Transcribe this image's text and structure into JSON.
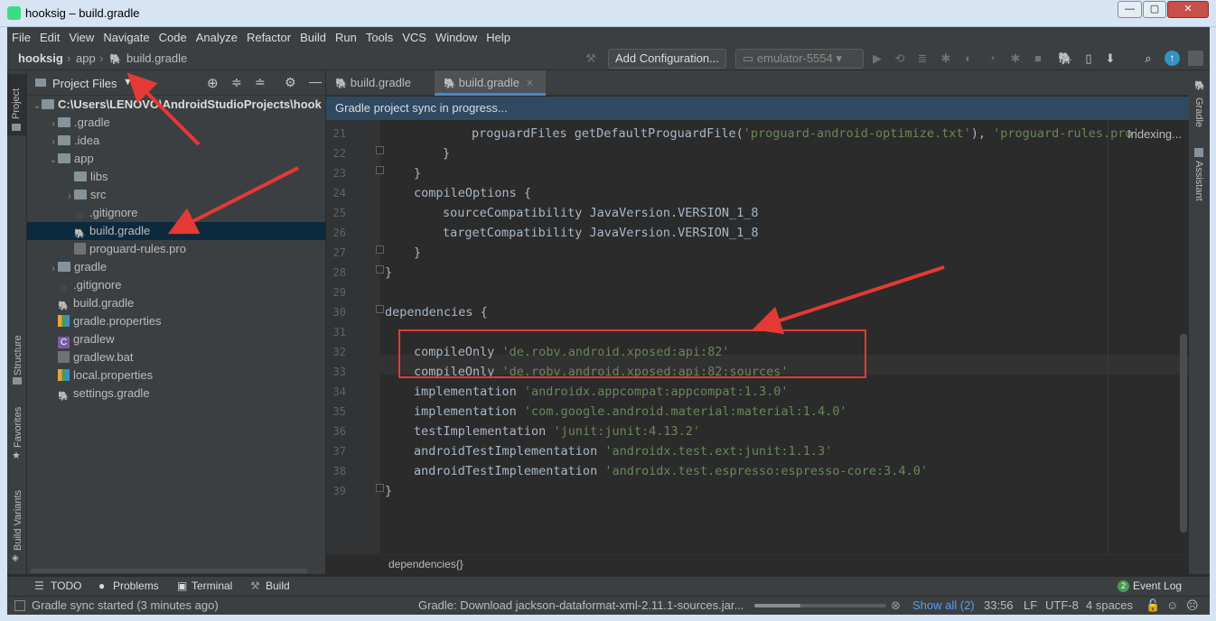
{
  "window": {
    "title": "hooksig – build.gradle"
  },
  "menu": [
    "File",
    "Edit",
    "View",
    "Navigate",
    "Code",
    "Analyze",
    "Refactor",
    "Build",
    "Run",
    "Tools",
    "VCS",
    "Window",
    "Help"
  ],
  "nav": {
    "project": "hooksig",
    "module": "app",
    "file": "build.gradle"
  },
  "toolbar": {
    "add_config": "Add Configuration...",
    "device": "emulator-5554"
  },
  "left_tabs": {
    "project": "Project",
    "structure": "Structure",
    "favorites": "Favorites",
    "build_variants": "Build Variants"
  },
  "right_tabs": {
    "gradle": "Gradle",
    "assistant": "Assistant"
  },
  "project_panel": {
    "view_selector": "Project Files",
    "tree": [
      {
        "label": "C:\\Users\\LENOVO\\AndroidStudioProjects\\hook",
        "depth": 0,
        "arrow": "down",
        "kind": "root"
      },
      {
        "label": ".gradle",
        "depth": 1,
        "arrow": "right",
        "kind": "folder"
      },
      {
        "label": ".idea",
        "depth": 1,
        "arrow": "right",
        "kind": "folder"
      },
      {
        "label": "app",
        "depth": 1,
        "arrow": "down",
        "kind": "folder"
      },
      {
        "label": "libs",
        "depth": 2,
        "arrow": "",
        "kind": "folder"
      },
      {
        "label": "src",
        "depth": 2,
        "arrow": "right",
        "kind": "folder"
      },
      {
        "label": ".gitignore",
        "depth": 2,
        "arrow": "",
        "kind": "git"
      },
      {
        "label": "build.gradle",
        "depth": 2,
        "arrow": "",
        "kind": "gradle",
        "selected": true
      },
      {
        "label": "proguard-rules.pro",
        "depth": 2,
        "arrow": "",
        "kind": "file"
      },
      {
        "label": "gradle",
        "depth": 1,
        "arrow": "right",
        "kind": "folder"
      },
      {
        "label": ".gitignore",
        "depth": 1,
        "arrow": "",
        "kind": "git"
      },
      {
        "label": "build.gradle",
        "depth": 1,
        "arrow": "",
        "kind": "gradle"
      },
      {
        "label": "gradle.properties",
        "depth": 1,
        "arrow": "",
        "kind": "props"
      },
      {
        "label": "gradlew",
        "depth": 1,
        "arrow": "",
        "kind": "exe"
      },
      {
        "label": "gradlew.bat",
        "depth": 1,
        "arrow": "",
        "kind": "bat"
      },
      {
        "label": "local.properties",
        "depth": 1,
        "arrow": "",
        "kind": "props"
      },
      {
        "label": "settings.gradle",
        "depth": 1,
        "arrow": "",
        "kind": "gradle"
      }
    ]
  },
  "editor": {
    "tabs": [
      {
        "label": "build.gradle",
        "active": false
      },
      {
        "label": "build.gradle",
        "active": true,
        "close": "×"
      }
    ],
    "sync_message": "Gradle project sync in progress...",
    "indexing": "Indexing...",
    "lines": [
      {
        "n": "21",
        "indent": 3,
        "parts": [
          [
            "proguardFiles getDefaultProguardFile(",
            ""
          ],
          [
            "'proguard-android-optimize.txt'",
            "str"
          ],
          [
            "), ",
            ""
          ],
          [
            "'proguard-rules.pro'",
            "str"
          ]
        ]
      },
      {
        "n": "22",
        "indent": 2,
        "parts": [
          [
            "}",
            ""
          ]
        ]
      },
      {
        "n": "23",
        "indent": 1,
        "parts": [
          [
            "}",
            ""
          ]
        ]
      },
      {
        "n": "24",
        "indent": 1,
        "parts": [
          [
            "compileOptions {",
            ""
          ]
        ]
      },
      {
        "n": "25",
        "indent": 2,
        "parts": [
          [
            "sourceCompatibility JavaVersion.VERSION_1_8",
            ""
          ]
        ]
      },
      {
        "n": "26",
        "indent": 2,
        "parts": [
          [
            "targetCompatibility JavaVersion.VERSION_1_8",
            ""
          ]
        ]
      },
      {
        "n": "27",
        "indent": 1,
        "parts": [
          [
            "}",
            ""
          ]
        ]
      },
      {
        "n": "28",
        "indent": 0,
        "parts": [
          [
            "}",
            ""
          ]
        ]
      },
      {
        "n": "29",
        "indent": 0,
        "parts": []
      },
      {
        "n": "30",
        "indent": 0,
        "parts": [
          [
            "dependencies {",
            ""
          ]
        ]
      },
      {
        "n": "31",
        "indent": 0,
        "parts": []
      },
      {
        "n": "32",
        "indent": 1,
        "parts": [
          [
            "compileOnly ",
            ""
          ],
          [
            "'de.robv.android.xposed:api:82'",
            "str"
          ]
        ]
      },
      {
        "n": "33",
        "indent": 1,
        "parts": [
          [
            "compileOnly ",
            ""
          ],
          [
            "'de.robv.android.xposed:api:82:sources'",
            "str"
          ]
        ]
      },
      {
        "n": "34",
        "indent": 1,
        "parts": [
          [
            "implementation ",
            ""
          ],
          [
            "'androidx.appcompat:appcompat:1.3.0'",
            "str"
          ]
        ]
      },
      {
        "n": "35",
        "indent": 1,
        "parts": [
          [
            "implementation ",
            ""
          ],
          [
            "'com.google.android.material:material:1.4.0'",
            "str"
          ]
        ]
      },
      {
        "n": "36",
        "indent": 1,
        "parts": [
          [
            "testImplementation ",
            ""
          ],
          [
            "'junit:junit:4.13.2'",
            "str"
          ]
        ]
      },
      {
        "n": "37",
        "indent": 1,
        "parts": [
          [
            "androidTestImplementation ",
            ""
          ],
          [
            "'androidx.test.ext:junit:1.1.3'",
            "str"
          ]
        ]
      },
      {
        "n": "38",
        "indent": 1,
        "parts": [
          [
            "androidTestImplementation ",
            ""
          ],
          [
            "'androidx.test.espresso:espresso-core:3.4.0'",
            "str"
          ]
        ]
      },
      {
        "n": "39",
        "indent": 0,
        "parts": [
          [
            "}",
            ""
          ]
        ]
      }
    ],
    "breadcrumb": "dependencies{}"
  },
  "bottom_tabs": {
    "todo": "TODO",
    "problems": "Problems",
    "terminal": "Terminal",
    "build": "Build",
    "event_log": "Event Log",
    "event_count": "2"
  },
  "status": {
    "left": "Gradle sync started (3 minutes ago)",
    "task": "Gradle: Download jackson-dataformat-xml-2.11.1-sources.jar...",
    "show_all": "Show all (2)",
    "position": "33:56",
    "line_sep": "LF",
    "encoding": "UTF-8",
    "indent": "4 spaces"
  },
  "colors": {
    "accent": "#4a88c7",
    "annotation": "#e53935",
    "string": "#6a8759",
    "code": "#a9b7c6"
  }
}
